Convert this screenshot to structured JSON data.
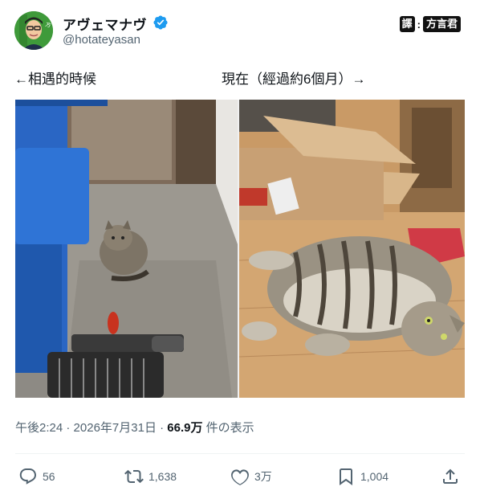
{
  "user": {
    "display_name": "アヴェマナヴ",
    "handle": "@hotateyasan"
  },
  "translate_badge": {
    "icon_label": "譯",
    "label": "方言君"
  },
  "tweet": {
    "caption_left": "←相遇的時候",
    "caption_right": "現在（經過約6個月）→"
  },
  "media": {
    "left_photo": "stray-tabby-cat-sitting-outdoors",
    "right_photo": "chubby-tabby-cat-lying-on-floor"
  },
  "meta": {
    "time": "午後2:24",
    "date": "2026年7月31日",
    "sep": "·",
    "views_count": "66.9万",
    "views_label": "件の表示"
  },
  "actions": {
    "replies": "56",
    "retweets": "1,638",
    "likes": "3万",
    "bookmarks": "1,004"
  },
  "colors": {
    "verified": "#1d9bf0",
    "muted": "#536471",
    "text": "#0f1419"
  }
}
